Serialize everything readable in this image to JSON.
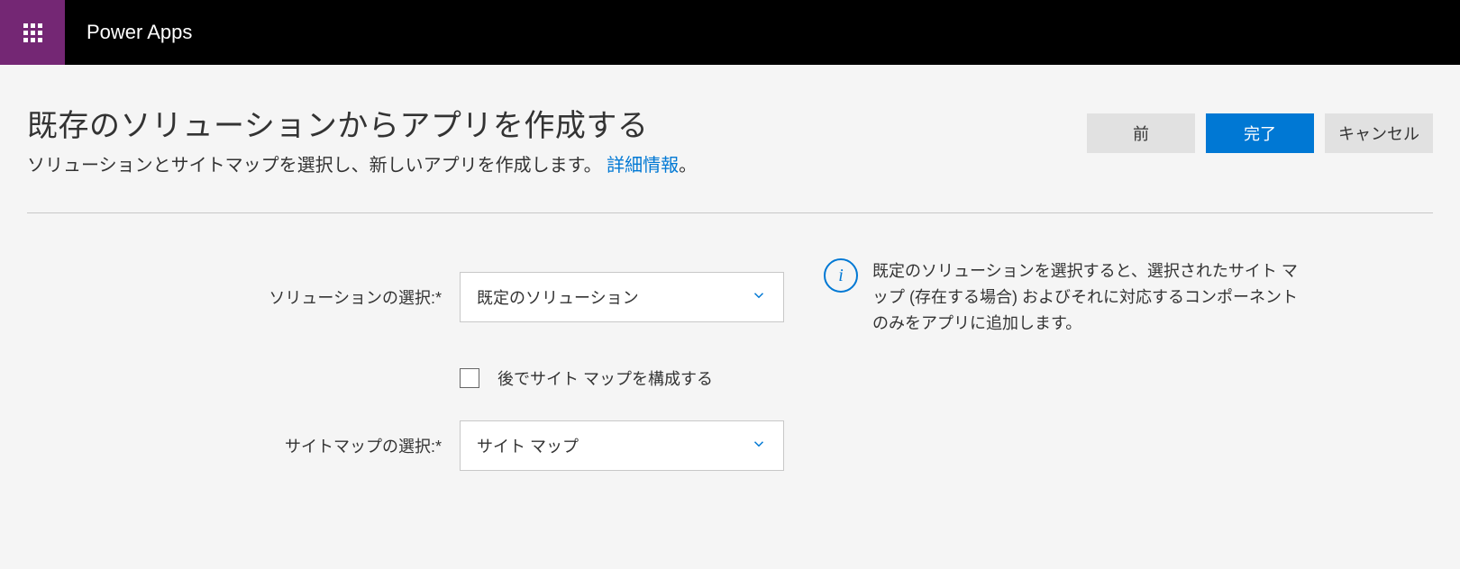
{
  "header": {
    "app_title": "Power Apps"
  },
  "page": {
    "title": "既存のソリューションからアプリを作成する",
    "subtitle_prefix": "ソリューションとサイトマップを選択し、新しいアプリを作成します。",
    "subtitle_link": "詳細情報",
    "subtitle_suffix": "。"
  },
  "buttons": {
    "prev": "前",
    "done": "完了",
    "cancel": "キャンセル"
  },
  "form": {
    "solution_label": "ソリューションの選択:*",
    "solution_value": "既定のソリューション",
    "configure_later_label": "後でサイト マップを構成する",
    "sitemap_label": "サイトマップの選択:*",
    "sitemap_value": "サイト マップ"
  },
  "info": {
    "text": "既定のソリューションを選択すると、選択されたサイト マップ (存在する場合) およびそれに対応するコンポーネントのみをアプリに追加します。"
  }
}
